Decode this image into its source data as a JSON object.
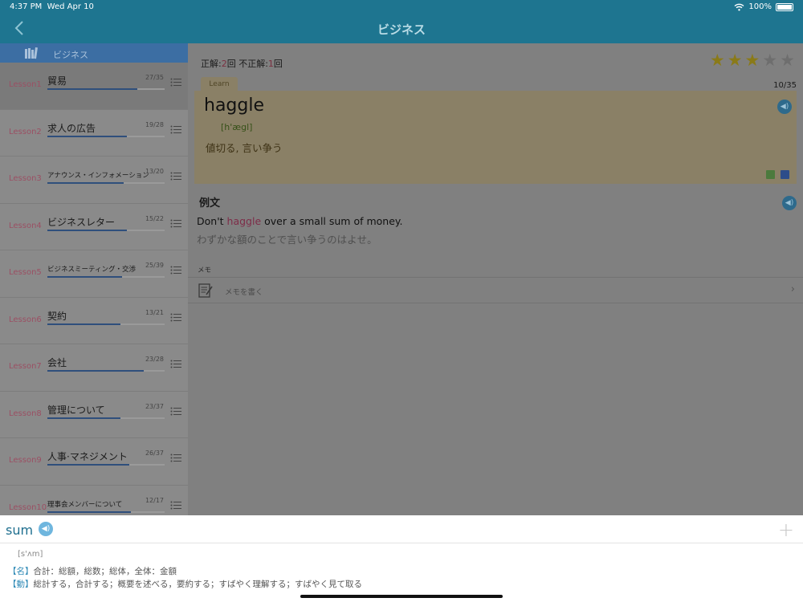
{
  "status": {
    "time": "4:37 PM",
    "date": "Wed Apr 10",
    "battery": "100%"
  },
  "nav": {
    "title": "ビジネス"
  },
  "sidebar": {
    "header": "ビジネス",
    "lessons": [
      {
        "num": "Lesson1",
        "name": "貿易",
        "count": "27/35",
        "progress": 0.77
      },
      {
        "num": "Lesson2",
        "name": "求人の広告",
        "count": "19/28",
        "progress": 0.68
      },
      {
        "num": "Lesson3",
        "name": "アナウンス・インフォメーション",
        "count": "13/20",
        "progress": 0.65
      },
      {
        "num": "Lesson4",
        "name": "ビジネスレター",
        "count": "15/22",
        "progress": 0.68
      },
      {
        "num": "Lesson5",
        "name": "ビジネスミーティング・交渉",
        "count": "25/39",
        "progress": 0.64
      },
      {
        "num": "Lesson6",
        "name": "契約",
        "count": "13/21",
        "progress": 0.62
      },
      {
        "num": "Lesson7",
        "name": "会社",
        "count": "23/28",
        "progress": 0.82
      },
      {
        "num": "Lesson8",
        "name": "管理について",
        "count": "23/37",
        "progress": 0.62
      },
      {
        "num": "Lesson9",
        "name": "人事·マネジメント",
        "count": "26/37",
        "progress": 0.7
      },
      {
        "num": "Lesson10",
        "name": "理事会メンバーについて",
        "count": "12/17",
        "progress": 0.71
      }
    ]
  },
  "main": {
    "score_correct_label": "正解:",
    "score_correct": "2",
    "score_mid": "回 不正解:",
    "score_wrong": "1",
    "score_end": "回",
    "stars_on": 3,
    "stars_total": 5,
    "tab": "Learn",
    "progress": "10/35",
    "word": "haggle",
    "phonetic": "[h'ægl]",
    "meaning": "値切る, 言い争う",
    "example_heading": "例文",
    "example_en_before": "Don't ",
    "example_en_hl": "haggle",
    "example_en_after": " over a small sum of money.",
    "example_ja": "わずかな額のことで言い争うのはよせ。",
    "memo_label": "メモ",
    "memo_placeholder": "メモを書く"
  },
  "dictionary": {
    "word": "sum",
    "phonetic": "[s'ʌm]",
    "pos_noun": "【名】",
    "def_noun": "合計：総額，総数；総体，全体：金額",
    "pos_verb": "【動】",
    "def_verb": "総計する，合計する；概要を述べる，要約する；すばやく理解する；すばやく見て取る"
  }
}
